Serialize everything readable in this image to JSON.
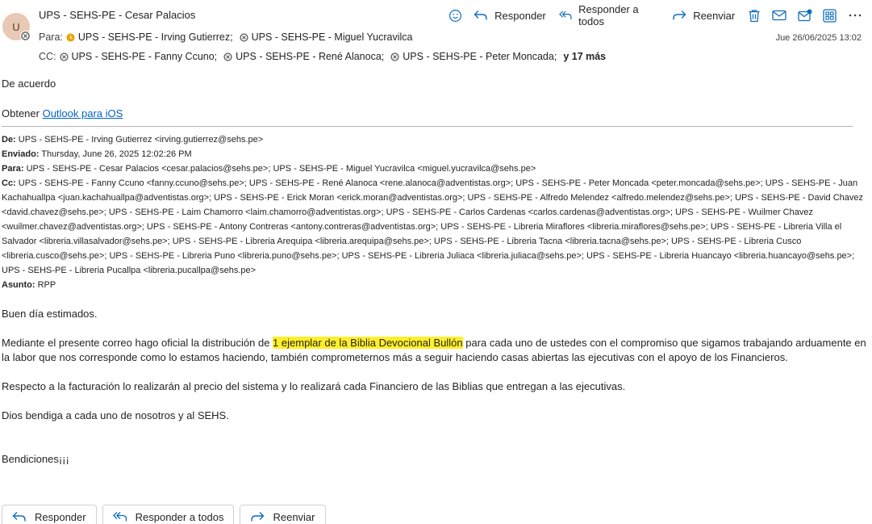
{
  "message": {
    "avatar_initial": "U",
    "sender": "UPS - SEHS-PE - Cesar Palacios",
    "to_label": "Para:",
    "to": [
      "UPS - SEHS-PE - Irving Gutierrez;",
      "UPS - SEHS-PE - Miguel Yucravilca"
    ],
    "cc_label": "CC:",
    "cc": [
      "UPS - SEHS-PE - Fanny Ccuno;",
      "UPS - SEHS-PE - René Alanoca;",
      "UPS - SEHS-PE - Peter Moncada;"
    ],
    "cc_more": "y 17 más",
    "date": "Jue 26/06/2025 13:02"
  },
  "toolbar": {
    "reply": "Responder",
    "reply_all": "Responder a todos",
    "forward": "Reenviar",
    "icons": [
      "emoji-icon",
      "delete-icon",
      "mark-read-icon",
      "report-icon",
      "apps-icon",
      "more-icon"
    ]
  },
  "body": {
    "line1": "De acuerdo",
    "line2_prefix": "Obtener ",
    "line2_link": "Outlook para iOS",
    "orig": {
      "from_label": "De:",
      "from": " UPS - SEHS-PE - Irving Gutierrez <irving.gutierrez@sehs.pe>",
      "sent_label": "Enviado:",
      "sent": " Thursday, June 26, 2025 12:02:26 PM",
      "to_label": "Para:",
      "to": " UPS - SEHS-PE - Cesar Palacios <cesar.palacios@sehs.pe>; UPS - SEHS-PE - Miguel Yucravilca <miguel.yucravilca@sehs.pe>",
      "cc_label": "Cc:",
      "cc": " UPS - SEHS-PE - Fanny Ccuno <fanny.ccuno@sehs.pe>; UPS - SEHS-PE - René Alanoca <rene.alanoca@adventistas.org>; UPS - SEHS-PE - Peter Moncada <peter.moncada@sehs.pe>; UPS - SEHS-PE - Juan Kachahuallpa <juan.kachahuallpa@adventistas.org>; UPS - SEHS-PE - Erick Moran <erick.moran@adventistas.org>; UPS - SEHS-PE - Alfredo Melendez <alfredo.melendez@sehs.pe>; UPS - SEHS-PE - David Chavez <david.chavez@sehs.pe>; UPS - SEHS-PE - Laim Chamorro <laim.chamorro@adventistas.org>; UPS - SEHS-PE - Carlos Cardenas <carlos.cardenas@adventistas.org>; UPS - SEHS-PE - Wuilmer Chavez <wuilmer.chavez@adventistas.org>; UPS - SEHS-PE - Antony Contreras <antony.contreras@adventistas.org>; UPS - SEHS-PE - Libreria Miraflores <libreria.miraflores@sehs.pe>; UPS - SEHS-PE - Libreria Villa el Salvador <libreria.villasalvador@sehs.pe>; UPS - SEHS-PE - Libreria Arequipa <libreria.arequipa@sehs.pe>; UPS - SEHS-PE - Libreria Tacna <libreria.tacna@sehs.pe>; UPS - SEHS-PE - Libreria Cusco <libreria.cusco@sehs.pe>; UPS - SEHS-PE - Libreria Puno <libreria.puno@sehs.pe>; UPS - SEHS-PE - Libreria Juliaca <libreria.juliaca@sehs.pe>; UPS - SEHS-PE - Libreria Huancayo <libreria.huancayo@sehs.pe>; UPS - SEHS-PE - Libreria Pucallpa <libreria.pucallpa@sehs.pe>",
      "subject_label": "Asunto:",
      "subject": " RPP"
    },
    "greeting": "Buen día estimados.",
    "p1_before": "Mediante el presente correo hago oficial la distribución de ",
    "p1_highlight": "1 ejemplar de la Biblia Devocional Bullón",
    "p1_after": " para cada uno de ustedes con el compromiso que sigamos trabajando arduamente en la labor que nos corresponde como lo estamos haciendo, también comprometernos más a seguir haciendo casas abiertas las ejecutivas con el apoyo de los Financieros.",
    "p2": "Respecto a la facturación lo realizarán al precio del sistema y lo realizará cada Financiero de las Biblias que entregan a las ejecutivas.",
    "p3": "Dios bendiga a cada uno de nosotros y al SEHS.",
    "closing": "Bendiciones¡¡¡"
  },
  "footer": {
    "reply": "Responder",
    "reply_all": "Responder a todos",
    "forward": "Reenviar"
  },
  "colors": {
    "accent": "#0f6cbd",
    "highlight": "#ffef29",
    "link": "#0563c1"
  }
}
